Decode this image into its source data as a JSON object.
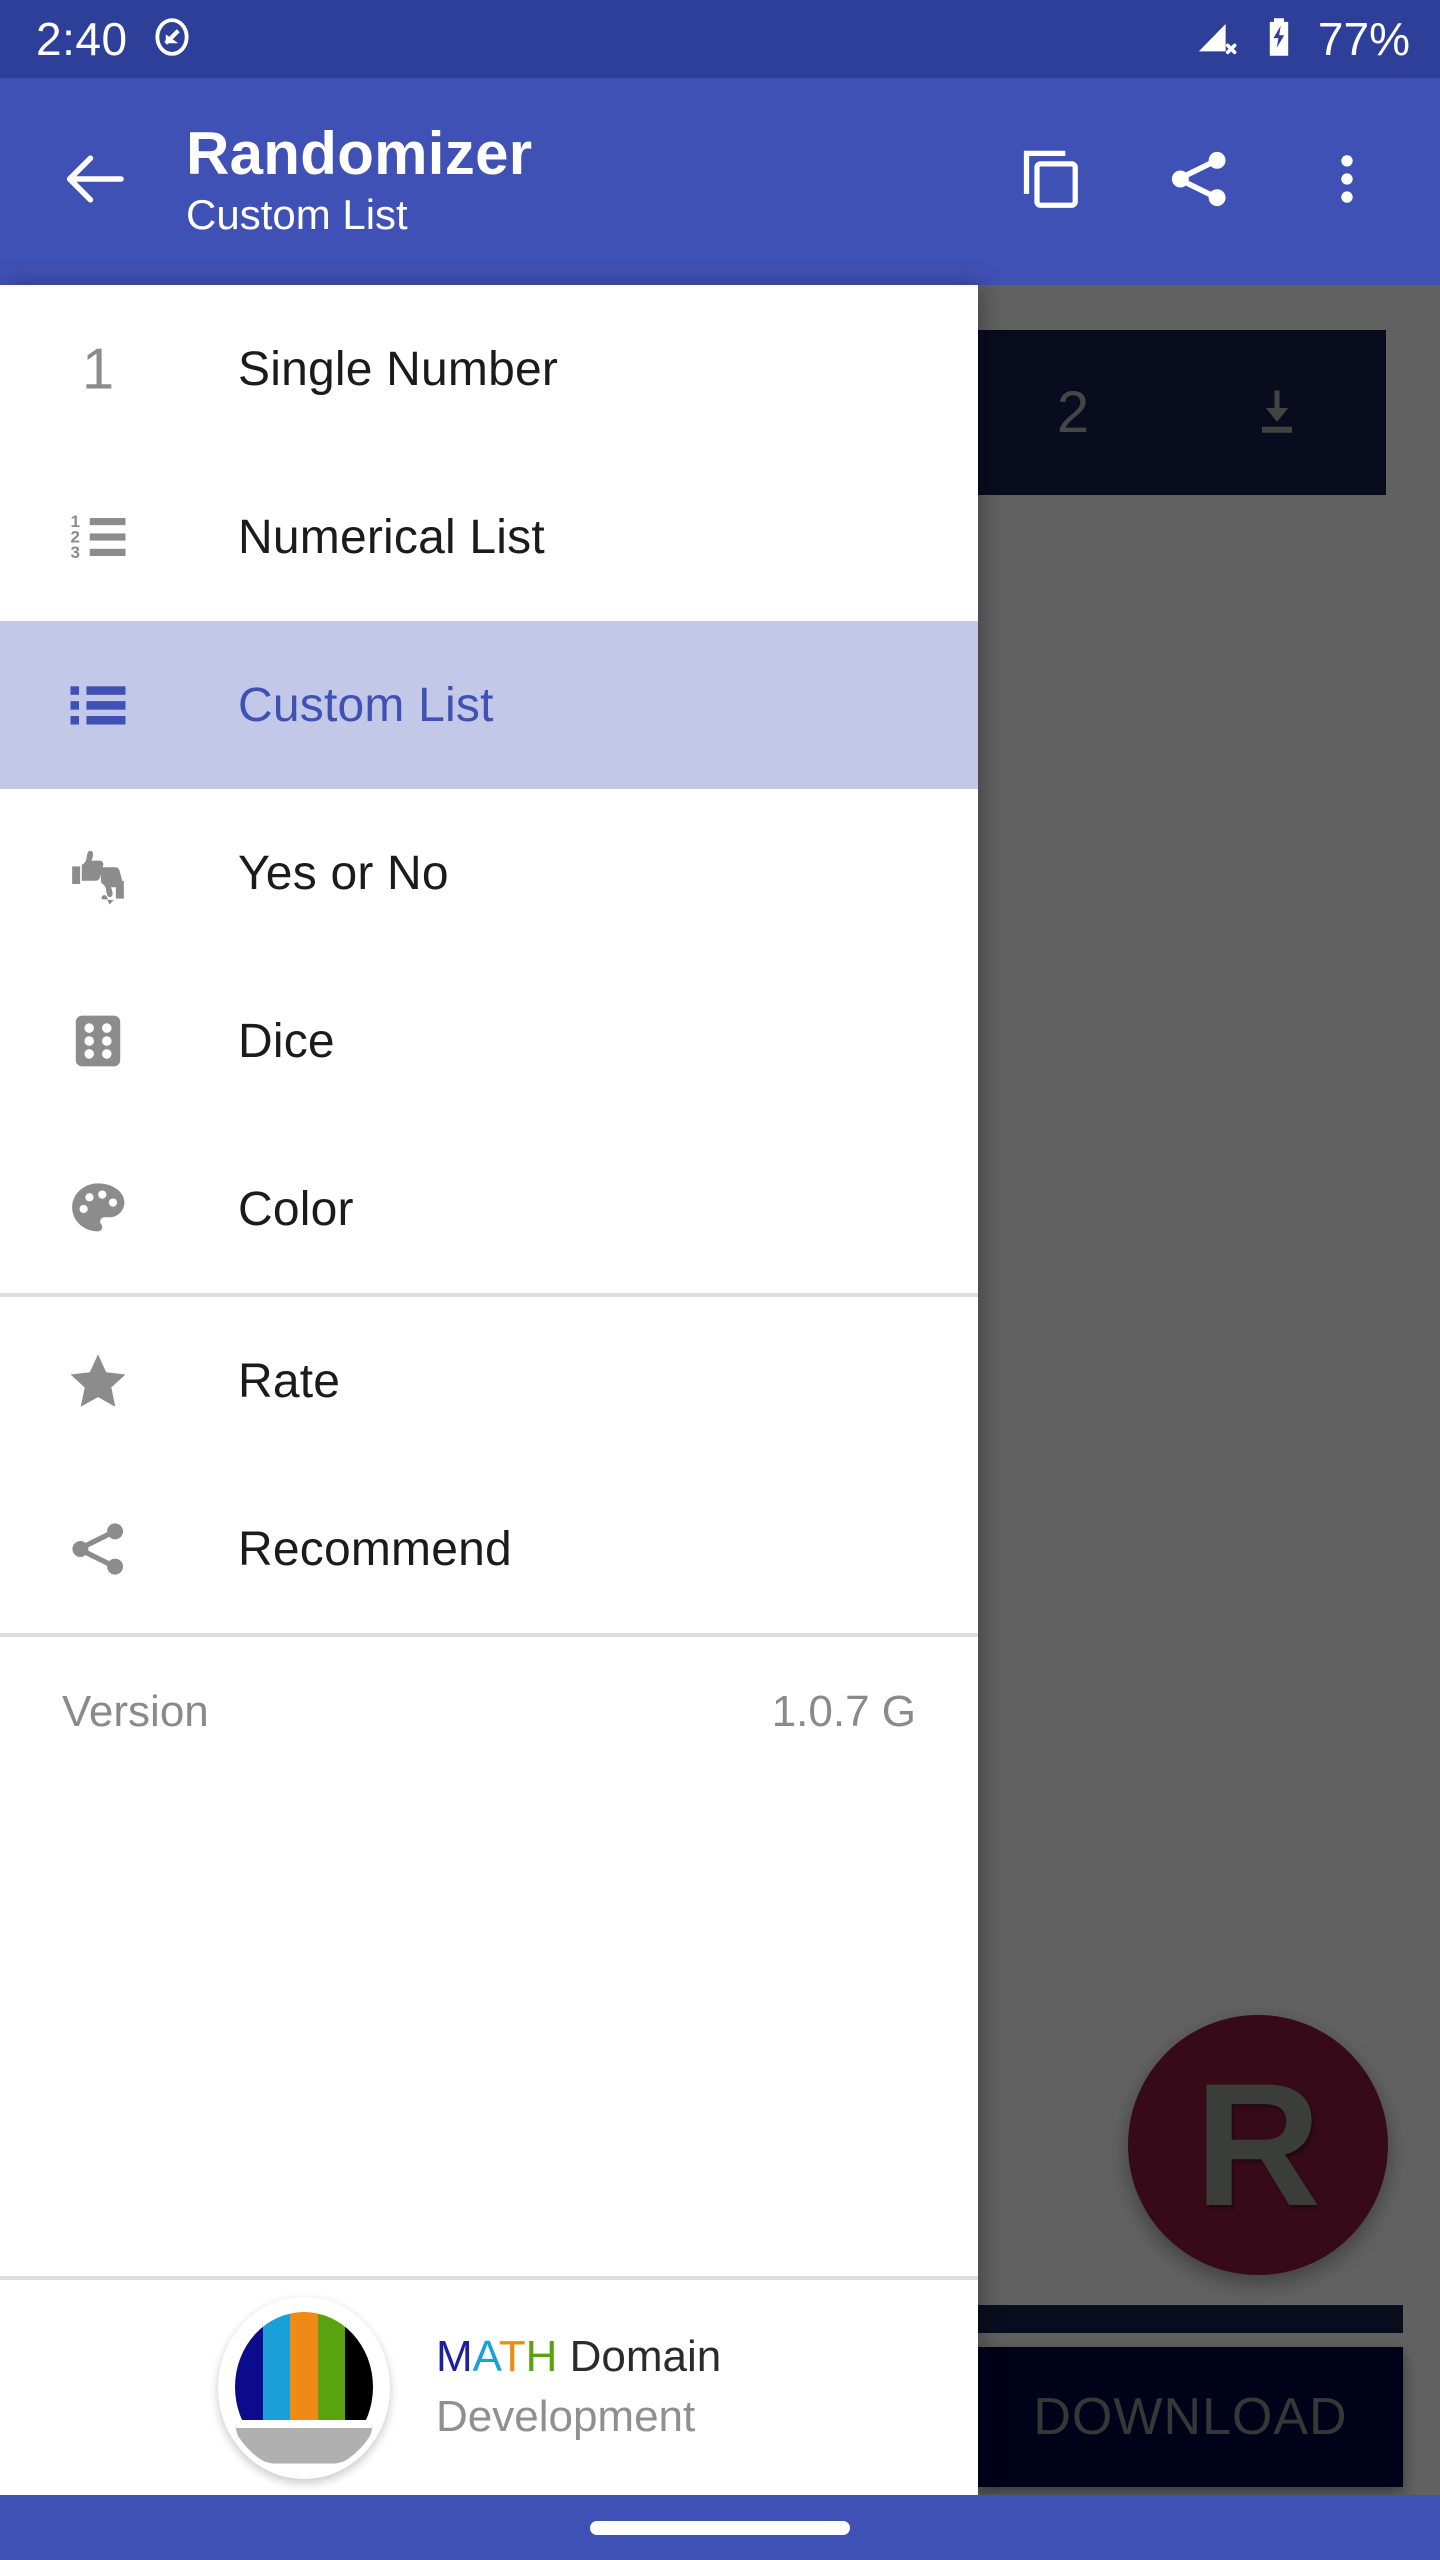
{
  "status_bar": {
    "clock": "2:40",
    "battery_percent": "77%",
    "icons": [
      "do-not-disturb-icon",
      "signal-no-sim-icon",
      "battery-charging-icon"
    ]
  },
  "app_bar": {
    "back_icon": "arrow-back-icon",
    "title": "Randomizer",
    "subtitle": "Custom List",
    "actions": [
      {
        "name": "copy-icon",
        "label": "Copy"
      },
      {
        "name": "share-icon",
        "label": "Share"
      },
      {
        "name": "overflow-menu-icon",
        "label": "More options"
      }
    ]
  },
  "drawer": {
    "primary_items": [
      {
        "label": "Single Number",
        "icon": "number-one-icon",
        "selected": false
      },
      {
        "label": "Numerical List",
        "icon": "numbered-list-icon",
        "selected": false
      },
      {
        "label": "Custom List",
        "icon": "bulleted-list-icon",
        "selected": true
      },
      {
        "label": "Yes or No",
        "icon": "thumbs-up-down-icon",
        "selected": false
      },
      {
        "label": "Dice",
        "icon": "dice-icon",
        "selected": false
      },
      {
        "label": "Color",
        "icon": "palette-icon",
        "selected": false
      }
    ],
    "secondary_items": [
      {
        "label": "Rate",
        "icon": "star-icon",
        "selected": false
      },
      {
        "label": "Recommend",
        "icon": "share-icon",
        "selected": false
      }
    ],
    "version": {
      "label": "Version",
      "value": "1.0.7 G"
    },
    "footer": {
      "logo": "math-domain-logo-icon",
      "brand_m": "M",
      "brand_a": "A",
      "brand_t": "T",
      "brand_h": "H",
      "brand_suffix": " Domain",
      "brand_line2": "Development",
      "logo_stripe_colors": [
        "#0b0b8c",
        "#19a0d8",
        "#f08a17",
        "#5aa310",
        "#000000"
      ]
    },
    "selected_background": "#c3c8e8",
    "selected_text_color": "#3f51b5"
  },
  "background_app": {
    "counter_value": "2",
    "download_row_icon": "download-icon",
    "fab_label": "R",
    "fab_color": "#8e1c42",
    "download_button_label": "DOWNLOAD",
    "download_button_color": "#020745"
  },
  "nav_bar": {
    "gesture_pill": "home-gesture-pill"
  },
  "theme": {
    "primary": "#3f51b5",
    "status_bar": "#2e3f99",
    "scrim": "rgba(0,0,0,0.62)",
    "divider": "#dedede"
  }
}
